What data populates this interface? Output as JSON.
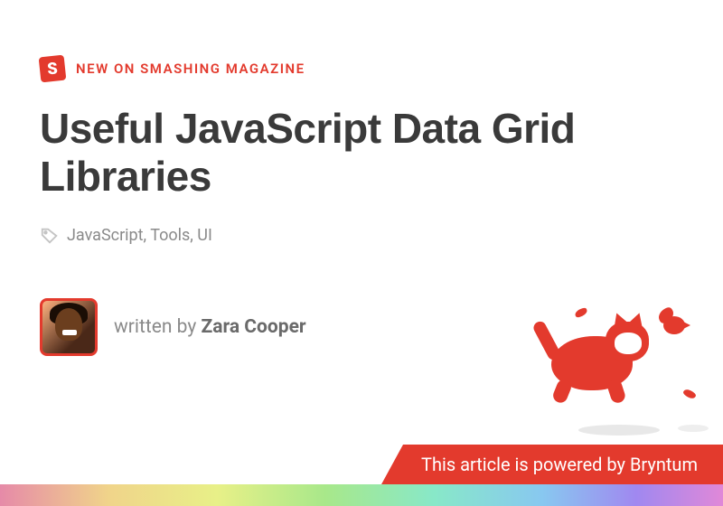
{
  "eyebrow": "NEW ON SMASHING MAGAZINE",
  "logo_letter": "S",
  "title": "Useful JavaScript Data Grid Libraries",
  "tags": "JavaScript, Tools, UI",
  "author": {
    "prefix": "written by ",
    "name": "Zara Cooper"
  },
  "sponsor": "This article is powered by Bryntum",
  "colors": {
    "accent": "#e33a2d"
  }
}
